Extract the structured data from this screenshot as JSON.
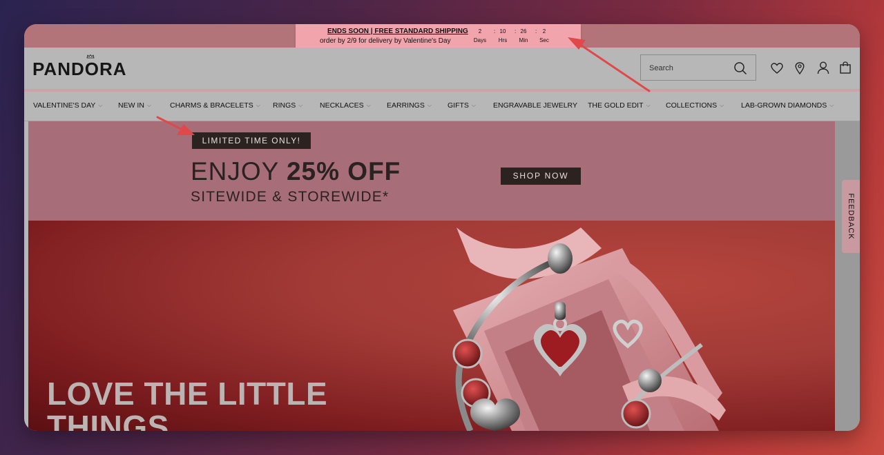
{
  "promo": {
    "shipping_link": "ENDS SOON | FREE STANDARD SHIPPING",
    "delivery_text": "order by 2/9 for delivery by Valentine's Day",
    "countdown": {
      "days": "2",
      "hours": "10",
      "minutes": "26",
      "seconds": "2",
      "days_label": "Days",
      "hours_label": "Hrs",
      "minutes_label": "Min",
      "seconds_label": "Sec",
      "separator": ":"
    }
  },
  "header": {
    "logo": "PANDORA",
    "search_placeholder": "Search",
    "icons": [
      "search-icon",
      "heart-icon",
      "location-pin-icon",
      "user-icon",
      "bag-icon"
    ]
  },
  "nav": {
    "items": [
      {
        "label": "VALENTINE'S DAY",
        "has_dropdown": true
      },
      {
        "label": "NEW IN",
        "has_dropdown": true
      },
      {
        "label": "CHARMS & BRACELETS",
        "has_dropdown": true
      },
      {
        "label": "RINGS",
        "has_dropdown": true
      },
      {
        "label": "NECKLACES",
        "has_dropdown": true
      },
      {
        "label": "EARRINGS",
        "has_dropdown": true
      },
      {
        "label": "GIFTS",
        "has_dropdown": true
      },
      {
        "label": "ENGRAVABLE JEWELRY",
        "has_dropdown": false
      },
      {
        "label": "THE GOLD EDIT",
        "has_dropdown": true
      },
      {
        "label": "COLLECTIONS",
        "has_dropdown": true
      },
      {
        "label": "LAB-GROWN DIAMONDS",
        "has_dropdown": true
      }
    ]
  },
  "banner": {
    "badge": "LIMITED TIME ONLY!",
    "headline_light": "ENJOY ",
    "headline_bold": "25% OFF",
    "subline": "SITEWIDE & STOREWIDE*",
    "cta": "SHOP NOW"
  },
  "hero": {
    "title_line1": "LOVE THE LITTLE",
    "title_line2": "THINGS"
  },
  "feedback_tab": "FEEDBACK",
  "colors": {
    "promo_strip": "#b27478",
    "countdown_bg": "#f2a4ad",
    "banner_bg": "#a76d78",
    "dark_button": "#2c2321",
    "annotation_arrow": "#e0484a"
  }
}
